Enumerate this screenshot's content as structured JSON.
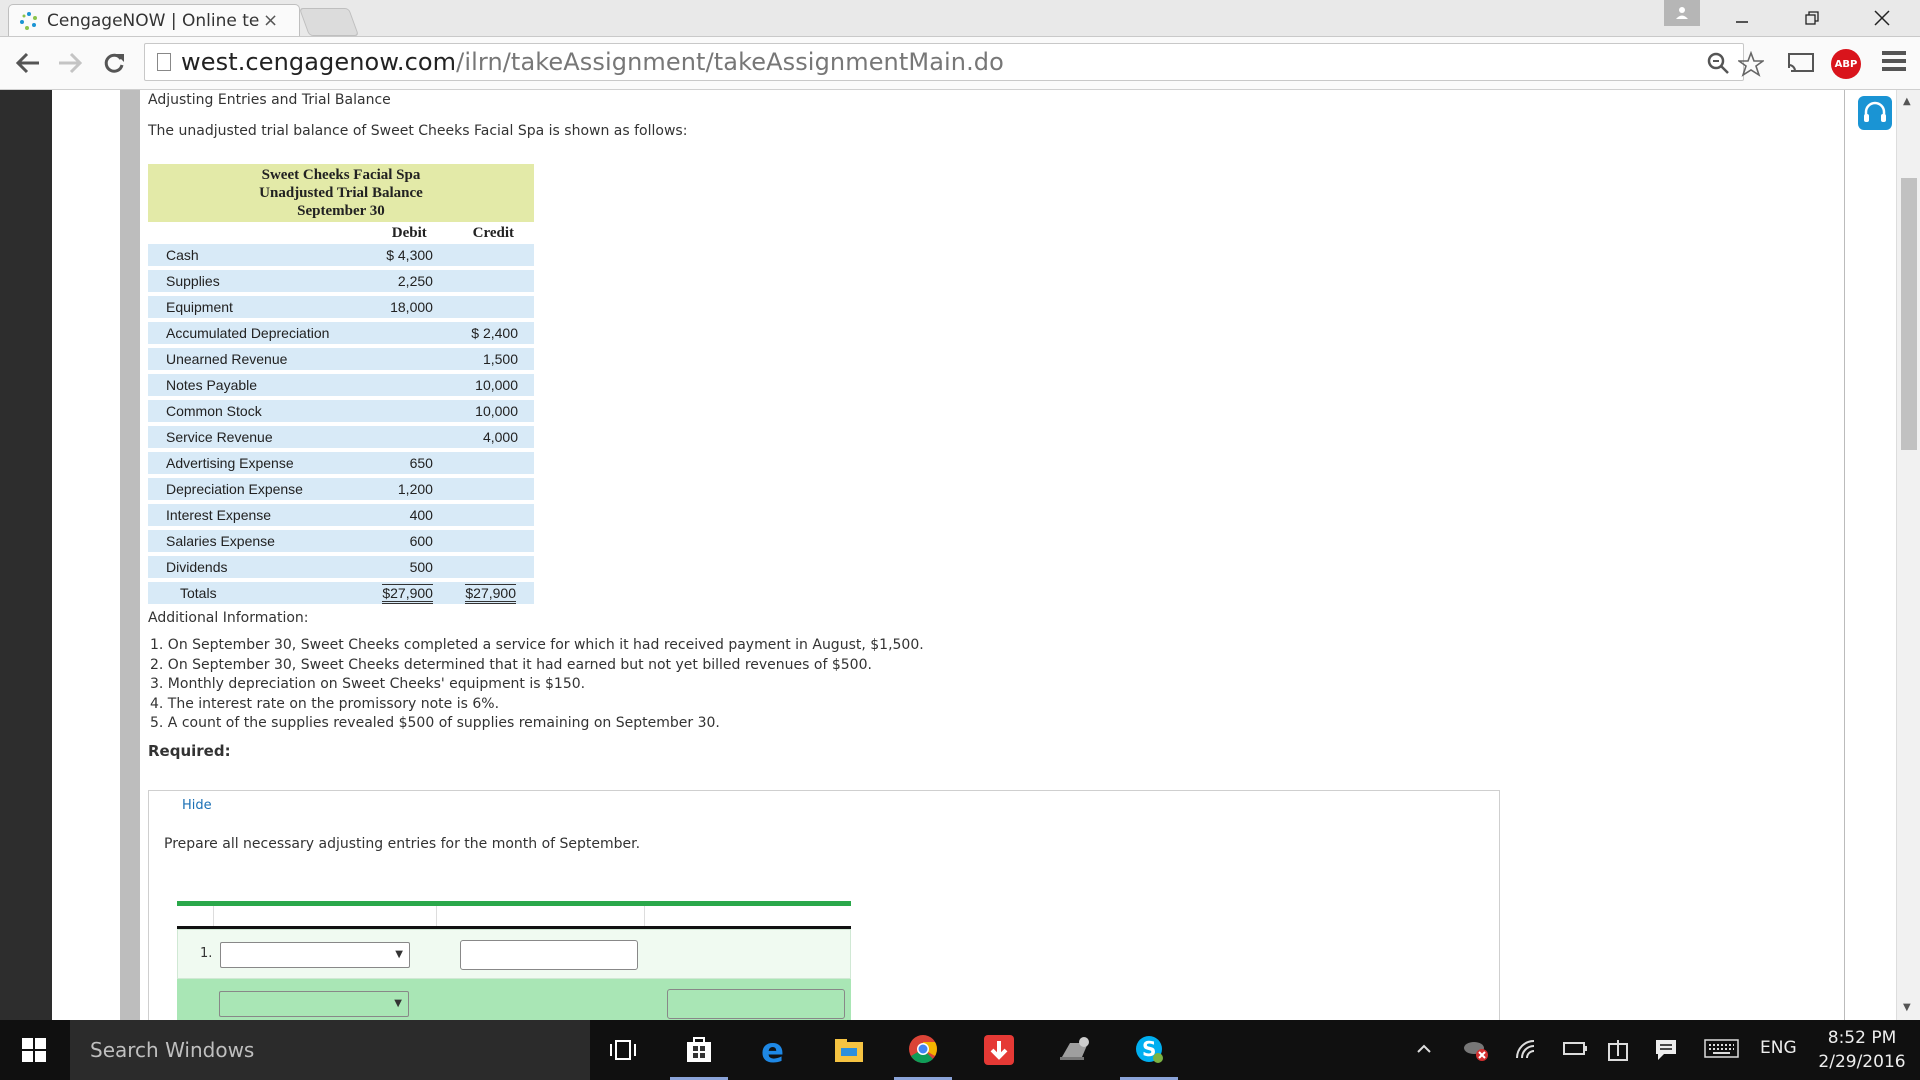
{
  "browser": {
    "tab_title": "CengageNOW | Online tea",
    "tab_close": "×",
    "url_host": "west.cengagenow.com",
    "url_path": "/ilrn/takeAssignment/takeAssignmentMain.do",
    "abp_label": "ABP"
  },
  "page": {
    "section_title": "Adjusting Entries and Trial Balance",
    "intro": "The unadjusted trial balance of Sweet Cheeks Facial Spa is shown as follows:",
    "trial_balance": {
      "company": "Sweet Cheeks Facial Spa",
      "statement": "Unadjusted Trial Balance",
      "date": "September 30",
      "debit_header": "Debit",
      "credit_header": "Credit",
      "rows": [
        {
          "account": "Cash",
          "debit": "$ 4,300",
          "credit": ""
        },
        {
          "account": "Supplies",
          "debit": "2,250",
          "credit": ""
        },
        {
          "account": "Equipment",
          "debit": "18,000",
          "credit": ""
        },
        {
          "account": "Accumulated Depreciation",
          "debit": "",
          "credit": "$ 2,400"
        },
        {
          "account": "Unearned Revenue",
          "debit": "",
          "credit": "1,500"
        },
        {
          "account": "Notes Payable",
          "debit": "",
          "credit": "10,000"
        },
        {
          "account": "Common Stock",
          "debit": "",
          "credit": "10,000"
        },
        {
          "account": "Service Revenue",
          "debit": "",
          "credit": "4,000"
        },
        {
          "account": "Advertising Expense",
          "debit": "650",
          "credit": ""
        },
        {
          "account": "Depreciation Expense",
          "debit": "1,200",
          "credit": ""
        },
        {
          "account": "Interest Expense",
          "debit": "400",
          "credit": ""
        },
        {
          "account": "Salaries Expense",
          "debit": "600",
          "credit": ""
        },
        {
          "account": "Dividends",
          "debit": "500",
          "credit": ""
        }
      ],
      "totals": {
        "label": "Totals",
        "debit": "$27,900",
        "credit": "$27,900"
      }
    },
    "additional_info_label": "Additional Information:",
    "info_items": [
      "1. On September 30, Sweet Cheeks completed a service for which it had received payment in August, $1,500.",
      "2. On September 30, Sweet Cheeks determined that it had earned but not yet billed revenues of $500.",
      "3. Monthly depreciation on Sweet Cheeks' equipment is $150.",
      "4. The interest rate on the promissory note is 6%.",
      "5. A count of the supplies revealed $500 of supplies remaining on September 30."
    ],
    "required_label": "Required:",
    "hide_link": "Hide",
    "prepare_text": "Prepare all necessary adjusting entries for the month of September.",
    "journal": {
      "row1_number": "1."
    }
  },
  "taskbar": {
    "search_placeholder": "Search Windows",
    "language": "ENG",
    "time": "8:52 PM",
    "date": "2/29/2016"
  },
  "colors": {
    "tb_header_bg": "#e3eaa8",
    "tb_row_bg": "#d8eaf7",
    "journal_accent": "#2aa84a",
    "journal_row_green": "#a9e6b5",
    "link_blue": "#1a6fb5",
    "help_button": "#1a94d4",
    "abp_red": "#d9141c"
  }
}
